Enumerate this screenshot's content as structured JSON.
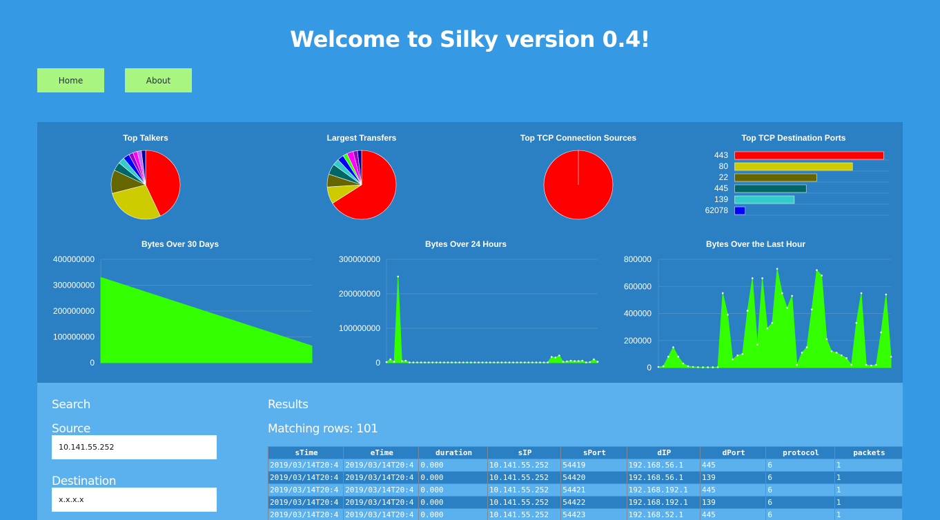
{
  "page": {
    "title": "Welcome to Silky version 0.4!"
  },
  "nav": {
    "home_label": "Home",
    "about_label": "About"
  },
  "colors": {
    "background": "#3599e3",
    "dashboard": "#2b7fc3",
    "lower_panel": "#5bb0ee",
    "nav_button": "#a8f57f",
    "area_fill": "#33ff00"
  },
  "chart_data": [
    {
      "type": "pie",
      "title": "Top Talkers",
      "slices": [
        {
          "value": 43,
          "color": "#ff0000"
        },
        {
          "value": 28,
          "color": "#cccc00"
        },
        {
          "value": 11,
          "color": "#666600"
        },
        {
          "value": 4,
          "color": "#006666"
        },
        {
          "value": 3,
          "color": "#33cccc"
        },
        {
          "value": 3,
          "color": "#0000ff"
        },
        {
          "value": 2,
          "color": "#9900cc"
        },
        {
          "value": 2,
          "color": "#ff00ff"
        },
        {
          "value": 2,
          "color": "#cc66ff"
        },
        {
          "value": 2,
          "color": "#000099"
        }
      ]
    },
    {
      "type": "pie",
      "title": "Largest Transfers",
      "slices": [
        {
          "value": 66,
          "color": "#ff0000"
        },
        {
          "value": 8,
          "color": "#cccc00"
        },
        {
          "value": 6,
          "color": "#666600"
        },
        {
          "value": 5,
          "color": "#006666"
        },
        {
          "value": 3,
          "color": "#33cccc"
        },
        {
          "value": 3,
          "color": "#0000ff"
        },
        {
          "value": 2,
          "color": "#33ff00"
        },
        {
          "value": 3,
          "color": "#ff00ff"
        },
        {
          "value": 2,
          "color": "#9900cc"
        },
        {
          "value": 2,
          "color": "#000099"
        }
      ]
    },
    {
      "type": "pie",
      "title": "Top TCP Connection Sources",
      "slices": [
        {
          "value": 100,
          "color": "#ff0000"
        }
      ]
    },
    {
      "type": "bar",
      "orientation": "horizontal",
      "title": "Top TCP Destination Ports",
      "categories": [
        "443",
        "80",
        "22",
        "445",
        "139",
        "62078"
      ],
      "values": [
        100,
        79,
        55,
        48,
        40,
        7
      ],
      "colors": [
        "#ff0000",
        "#cccc00",
        "#666600",
        "#006666",
        "#33cccc",
        "#0000ff"
      ]
    },
    {
      "type": "area",
      "title": "Bytes Over 30 Days",
      "ylim": [
        0,
        400000000
      ],
      "yticks": [
        "0",
        "100000000",
        "200000000",
        "300000000",
        "400000000"
      ],
      "y": [
        330000000,
        65000000
      ],
      "show_points": false
    },
    {
      "type": "area",
      "title": "Bytes Over 24 Hours",
      "ylim": [
        0,
        300000000
      ],
      "yticks": [
        "0",
        "100000000",
        "200000000",
        "300000000"
      ],
      "y": [
        2000000,
        10000000,
        3000000,
        250000000,
        5000000,
        6000000,
        1000000,
        1000000,
        1000000,
        1000000,
        1000000,
        1000000,
        1000000,
        1000000,
        1000000,
        1000000,
        1000000,
        1000000,
        1000000,
        1000000,
        1000000,
        1000000,
        1000000,
        1000000,
        1000000,
        1000000,
        1000000,
        1000000,
        1000000,
        1000000,
        1000000,
        1000000,
        1000000,
        1000000,
        1000000,
        1000000,
        1000000,
        1000000,
        1000000,
        1000000,
        1000000,
        1000000,
        1000000,
        17000000,
        15000000,
        21000000,
        3000000,
        4000000,
        6000000,
        5000000,
        5000000,
        6000000,
        1000000,
        2000000,
        10000000,
        3000000
      ],
      "show_points": true
    },
    {
      "type": "area",
      "title": "Bytes Over the Last Hour",
      "ylim": [
        0,
        800000
      ],
      "yticks": [
        "0",
        "200000",
        "400000",
        "600000",
        "800000"
      ],
      "y": [
        5000,
        10000,
        80000,
        150000,
        80000,
        30000,
        10000,
        5000,
        3000,
        2000,
        2000,
        2000,
        3000,
        550000,
        390000,
        60000,
        90000,
        100000,
        420000,
        660000,
        170000,
        660000,
        290000,
        330000,
        730000,
        550000,
        440000,
        530000,
        20000,
        110000,
        150000,
        430000,
        720000,
        680000,
        210000,
        120000,
        110000,
        90000,
        70000,
        20000,
        330000,
        550000,
        20000,
        15000,
        20000,
        260000,
        540000,
        80000
      ],
      "show_points": true
    }
  ],
  "search": {
    "heading": "Search",
    "source_label": "Source",
    "source_value": "10.141.55.252",
    "destination_label": "Destination",
    "destination_value": "x.x.x.x"
  },
  "results": {
    "heading": "Results",
    "matching_rows": "Matching rows: 101",
    "columns": [
      "sTime",
      "eTime",
      "duration",
      "sIP",
      "sPort",
      "dIP",
      "dPort",
      "protocol",
      "packets"
    ],
    "rows": [
      [
        "2019/03/14T20:4",
        "2019/03/14T20:4",
        "0.000",
        "10.141.55.252",
        "54419",
        "192.168.56.1",
        "445",
        "6",
        "1"
      ],
      [
        "2019/03/14T20:4",
        "2019/03/14T20:4",
        "0.000",
        "10.141.55.252",
        "54420",
        "192.168.56.1",
        "139",
        "6",
        "1"
      ],
      [
        "2019/03/14T20:4",
        "2019/03/14T20:4",
        "0.000",
        "10.141.55.252",
        "54421",
        "192.168.192.1",
        "445",
        "6",
        "1"
      ],
      [
        "2019/03/14T20:4",
        "2019/03/14T20:4",
        "0.000",
        "10.141.55.252",
        "54422",
        "192.168.192.1",
        "139",
        "6",
        "1"
      ],
      [
        "2019/03/14T20:4",
        "2019/03/14T20:4",
        "0.000",
        "10.141.55.252",
        "54423",
        "192.168.52.1",
        "445",
        "6",
        "1"
      ]
    ]
  }
}
